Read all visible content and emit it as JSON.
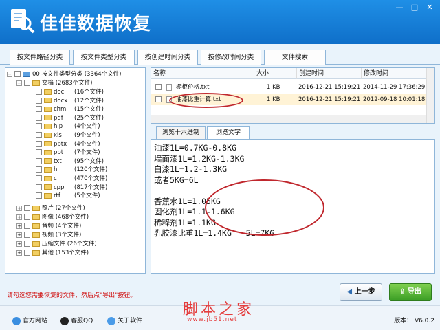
{
  "app": {
    "title": "佳佳数据恢复"
  },
  "window_buttons": {
    "minimize": "—",
    "maximize": "□",
    "close": "✕"
  },
  "tabs": [
    {
      "label": "按文件路径分类"
    },
    {
      "label": "按文件类型分类"
    },
    {
      "label": "按创建时间分类"
    },
    {
      "label": "按修改时间分类"
    },
    {
      "label": "文件搜索"
    }
  ],
  "tree": {
    "root": {
      "label": "00 按文件类型分类",
      "count": "(3364个文件)"
    },
    "documents": {
      "label": "文档",
      "count": "(2683个文件)"
    },
    "doc_types": [
      {
        "label": "doc",
        "count": "(16个文件)"
      },
      {
        "label": "docx",
        "count": "(12个文件)"
      },
      {
        "label": "chm",
        "count": "(15个文件)"
      },
      {
        "label": "pdf",
        "count": "(25个文件)"
      },
      {
        "label": "hlp",
        "count": "(4个文件)"
      },
      {
        "label": "xls",
        "count": "(9个文件)"
      },
      {
        "label": "pptx",
        "count": "(4个文件)"
      },
      {
        "label": "ppt",
        "count": "(7个文件)"
      },
      {
        "label": "txt",
        "count": "(95个文件)"
      },
      {
        "label": "h",
        "count": "(120个文件)"
      },
      {
        "label": "c",
        "count": "(470个文件)"
      },
      {
        "label": "cpp",
        "count": "(817个文件)"
      },
      {
        "label": "rtf",
        "count": "(5个文件)"
      }
    ],
    "others": [
      {
        "label": "照片",
        "count": "(27个文件)"
      },
      {
        "label": "图像",
        "count": "(468个文件)"
      },
      {
        "label": "音频",
        "count": "(4个文件)"
      },
      {
        "label": "视频",
        "count": "(3个文件)"
      },
      {
        "label": "压缩文件",
        "count": "(26个文件)"
      },
      {
        "label": "其他",
        "count": "(153个文件)"
      }
    ]
  },
  "filelist": {
    "columns": [
      "名称",
      "大小",
      "创建时间",
      "修改时间"
    ],
    "rows": [
      {
        "name": "橱柜价格.txt",
        "size": "1 KB",
        "created": "2016-12-21 15:19:21",
        "modified": "2014-11-29 17:36:29"
      },
      {
        "name": "油漆比重计算.txt",
        "size": "1 KB",
        "created": "2016-12-21 15:19:21",
        "modified": "2012-09-18 10:01:18"
      }
    ]
  },
  "preview_tabs": [
    {
      "label": "浏览十六进制"
    },
    {
      "label": "浏览文字"
    }
  ],
  "preview_lines": [
    "油漆1L=0.7KG-0.8KG",
    "墙面漆1L=1.2KG-1.3KG",
    "白漆1L=1.2-1.3KG",
    "或者5KG=6L",
    "",
    "香蕉水1L=1.05KG",
    "固化剂1L=1.1-1.6KG",
    "稀释剂1L=1.1KG",
    "乳胶漆比重1L=1.4KG   5L=7KG"
  ],
  "bottom": {
    "hint": "请勾选您需要恢复的文件，然后点\"导出\"按钮。",
    "prev_label": "上一步",
    "export_label": "导出"
  },
  "footer": {
    "links": [
      {
        "label": "官方网站"
      },
      {
        "label": "客服QQ"
      },
      {
        "label": "关于软件"
      }
    ],
    "watermark_title": "脚本之家",
    "watermark_url": "www.jb51.net",
    "version": "版本： V6.0.2"
  },
  "colors": {
    "title_bar": "#1580da",
    "accent_red": "#c0272d",
    "export_green": "#3b9e25"
  }
}
